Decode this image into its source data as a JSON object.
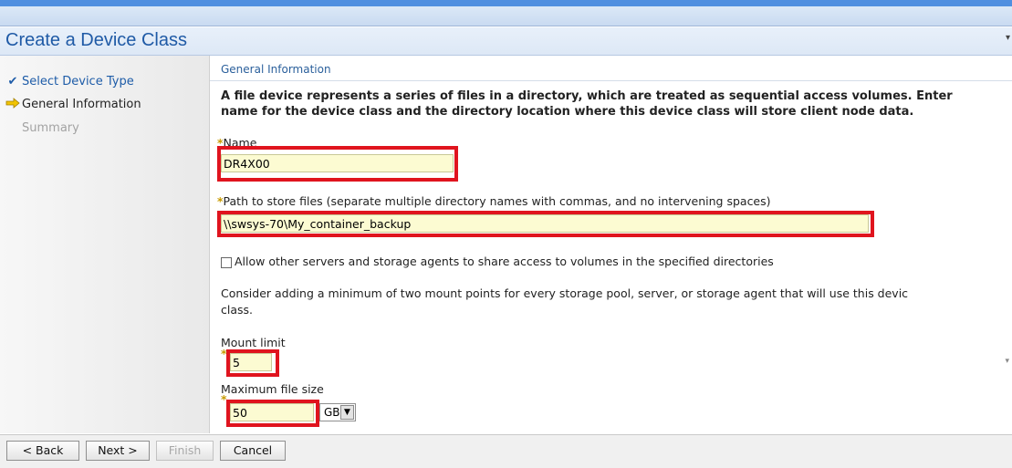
{
  "window": {
    "title": "Create a Device Class"
  },
  "steps": [
    {
      "label": "Select Device Type",
      "state": "done",
      "icon": "checkmark-icon"
    },
    {
      "label": "General Information",
      "state": "current",
      "icon": "arrow-right-icon"
    },
    {
      "label": "Summary",
      "state": "pending"
    }
  ],
  "section": {
    "title": "General Information",
    "description_line1": "A file device represents a series of files in a directory, which are treated as sequential access volumes. Enter",
    "description_line2": "name for the device class and the directory location where this device class will store client node data."
  },
  "form": {
    "name": {
      "label": "Name",
      "value": "DR4X00"
    },
    "path": {
      "label": "Path to store files (separate multiple directory names with commas, and no intervening spaces)",
      "value": "\\\\swsys-70\\My_container_backup"
    },
    "share": {
      "label": "Allow other servers and storage agents to share access to volumes in the specified directories",
      "checked": false
    },
    "note_line1": "Consider adding a minimum of two mount points for every storage pool, server, or storage agent that will use this devic",
    "note_line2": "class.",
    "mount_limit": {
      "label": "Mount limit",
      "value": "5"
    },
    "max_file_size": {
      "label": "Maximum file size",
      "value": "50",
      "unit": "GB"
    }
  },
  "footer": {
    "back": "< Back",
    "next": "Next >",
    "finish": "Finish",
    "cancel": "Cancel"
  },
  "colors": {
    "highlight": "#e0141e",
    "field_bg": "#fcfbd2",
    "accent": "#1e5ca8"
  }
}
